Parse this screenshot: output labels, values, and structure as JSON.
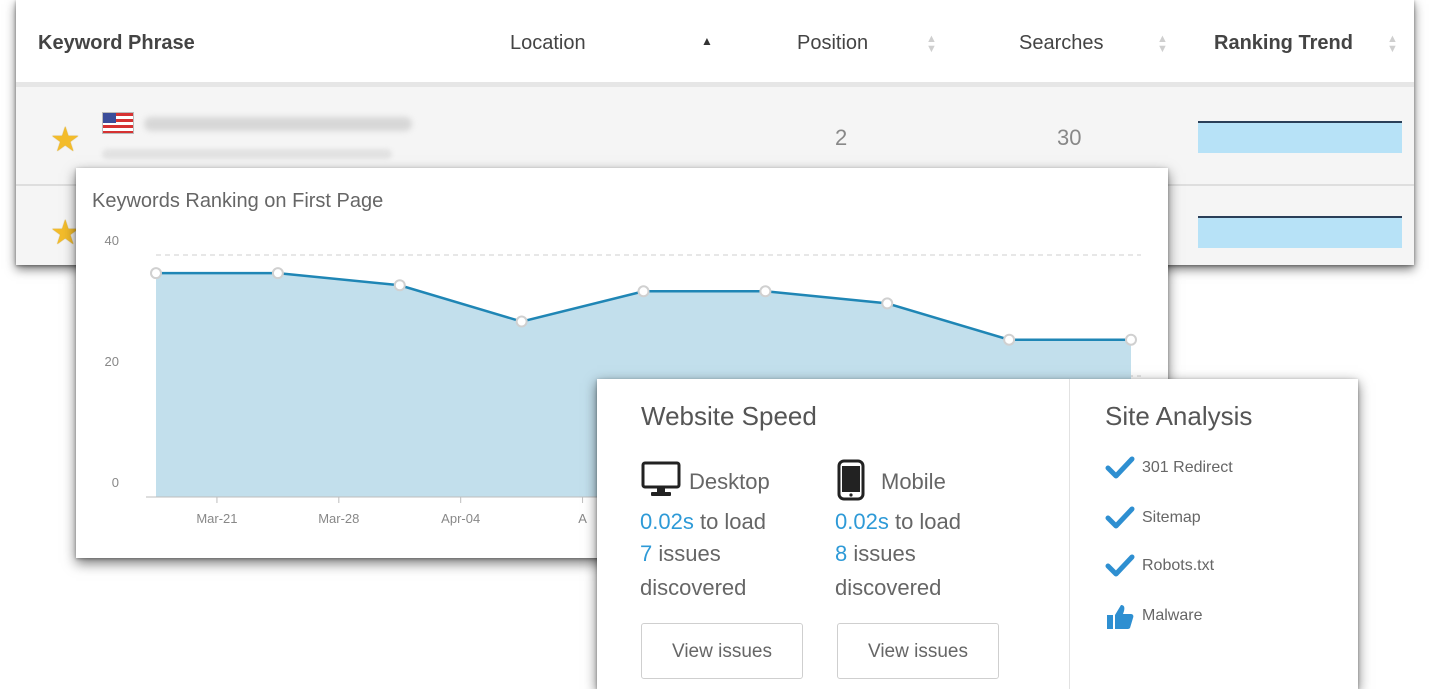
{
  "keywords_table": {
    "columns": [
      {
        "label": "Keyword Phrase"
      },
      {
        "label": "Location"
      },
      {
        "label": "Position"
      },
      {
        "label": "Searches"
      },
      {
        "label": "Ranking Trend"
      }
    ],
    "rows": [
      {
        "position": "2",
        "searches": "30"
      },
      {
        "position": "",
        "searches": ""
      }
    ]
  },
  "chart": {
    "title": "Keywords Ranking on First Page"
  },
  "chart_data": {
    "type": "area",
    "title": "Keywords Ranking on First Page",
    "x_ticks": [
      "Mar-21",
      "Mar-28",
      "Apr-04",
      "A"
    ],
    "y_ticks": [
      0,
      20,
      40
    ],
    "ylim": [
      0,
      40
    ],
    "values": [
      37,
      37,
      35,
      29,
      34,
      34,
      32,
      26,
      26
    ],
    "grid": true,
    "line_color": "#1f86b5",
    "fill_color": "#c2dfec"
  },
  "website_speed": {
    "title": "Website Speed",
    "devices": [
      {
        "name": "Desktop",
        "icon": "monitor-icon",
        "load_time": "0.02s",
        "load_suffix": "to load",
        "issues_count": "7",
        "issues_word": "issues",
        "discovered": "discovered",
        "button": "View issues"
      },
      {
        "name": "Mobile",
        "icon": "mobile-icon",
        "load_time": "0.02s",
        "load_suffix": "to load",
        "issues_count": "8",
        "issues_word": "issues",
        "discovered": "discovered",
        "button": "View issues"
      }
    ]
  },
  "site_analysis": {
    "title": "Site Analysis",
    "items": [
      {
        "label": "301 Redirect",
        "icon": "check-icon"
      },
      {
        "label": "Sitemap",
        "icon": "check-icon"
      },
      {
        "label": "Robots.txt",
        "icon": "check-icon"
      },
      {
        "label": "Malware",
        "icon": "thumbs-up-icon"
      }
    ]
  },
  "colors": {
    "accent": "#2e9ad7",
    "star": "#f3bc2b",
    "trend_fill": "#b7e2f7"
  }
}
